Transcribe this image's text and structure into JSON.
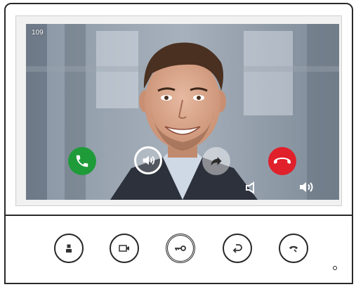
{
  "screen": {
    "channel_label": "109"
  },
  "onscreen_buttons": [
    {
      "name": "answer-call-button",
      "icon": "phone-icon",
      "color": "#1f9b3a"
    },
    {
      "name": "speaker-toggle-button",
      "icon": "speaker-icon"
    },
    {
      "name": "forward-call-button",
      "icon": "forward-arrow-icon"
    },
    {
      "name": "hang-up-button",
      "icon": "phone-hangup-icon",
      "color": "#e0202a"
    }
  ],
  "volume": {
    "down_icon": "volume-down-icon",
    "up_icon": "volume-up-icon"
  },
  "hardware_buttons": [
    {
      "name": "monitor-button",
      "icon": "person-icon"
    },
    {
      "name": "camera-button",
      "icon": "camera-icon"
    },
    {
      "name": "unlock-button",
      "icon": "key-icon"
    },
    {
      "name": "return-button",
      "icon": "return-arrow-icon"
    },
    {
      "name": "talk-button",
      "icon": "handset-icon"
    }
  ]
}
